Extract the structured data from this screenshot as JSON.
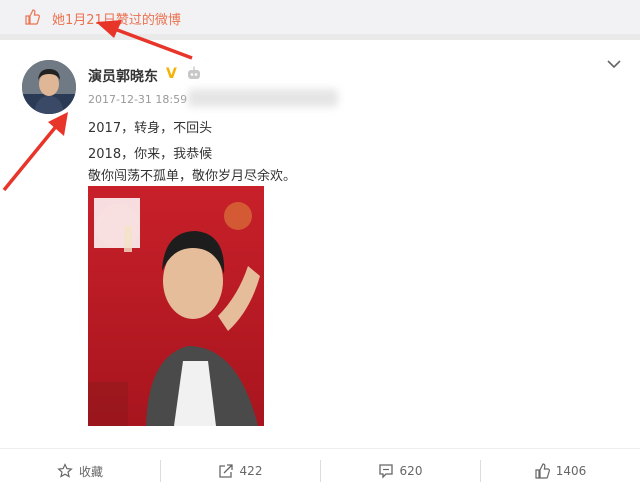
{
  "top_notice": {
    "text": "她1月21日赞过的微博"
  },
  "post": {
    "username": "演员郭晓东",
    "verified_mark": "V",
    "timestamp": "2017-12-31 18:59",
    "lines": [
      "2017，转身，不回头",
      "2018，你来，我恭候",
      "敬你闯荡不孤单，敬你岁月尽余欢。"
    ]
  },
  "actions": {
    "favorite": {
      "label": "收藏"
    },
    "repost": {
      "count": "422"
    },
    "comment": {
      "count": "620"
    },
    "like": {
      "count": "1406"
    }
  },
  "colors": {
    "accent": "#eb7350",
    "verified": "#f7b100",
    "arrow": "#e8352a"
  }
}
